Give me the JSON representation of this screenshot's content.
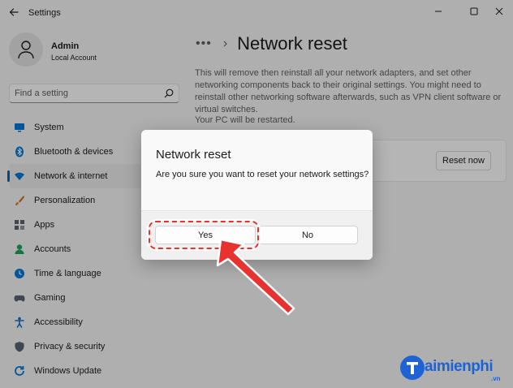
{
  "window": {
    "title": "Settings",
    "controls": [
      "minimize-icon",
      "maximize-icon",
      "close-icon"
    ]
  },
  "user": {
    "name": "Admin",
    "account_type": "Local Account"
  },
  "search": {
    "placeholder": "Find a setting"
  },
  "sidebar": {
    "items": [
      {
        "label": "System",
        "icon": "monitor-icon",
        "color": "#0078d4"
      },
      {
        "label": "Bluetooth & devices",
        "icon": "bluetooth-icon",
        "color": "#0078d4"
      },
      {
        "label": "Network & internet",
        "icon": "wifi-icon",
        "color": "#0078d4",
        "active": true
      },
      {
        "label": "Personalization",
        "icon": "brush-icon",
        "color": "#c96d1a"
      },
      {
        "label": "Apps",
        "icon": "apps-icon",
        "color": "#5a6270"
      },
      {
        "label": "Accounts",
        "icon": "person-icon",
        "color": "#1aa260"
      },
      {
        "label": "Time & language",
        "icon": "globe-clock-icon",
        "color": "#0078d4"
      },
      {
        "label": "Gaming",
        "icon": "gamepad-icon",
        "color": "#5a6270"
      },
      {
        "label": "Accessibility",
        "icon": "accessibility-icon",
        "color": "#0f6cbd"
      },
      {
        "label": "Privacy & security",
        "icon": "shield-icon",
        "color": "#5a6270"
      },
      {
        "label": "Windows Update",
        "icon": "refresh-icon",
        "color": "#0078d4"
      }
    ]
  },
  "content": {
    "breadcrumb_more": "•••",
    "breadcrumb_sep": "›",
    "title": "Network reset",
    "description": "This will remove then reinstall all your network adapters, and set other networking components back to their original settings. You might need to reinstall other networking software afterwards, such as VPN client software or virtual switches.",
    "restart_note": "Your PC will be restarted.",
    "reset_button": "Reset now"
  },
  "dialog": {
    "title": "Network reset",
    "message": "Are you sure you want to reset your network settings?",
    "yes_label": "Yes",
    "no_label": "No"
  },
  "annotation": {
    "color": "#e8322f",
    "target": "Yes"
  },
  "watermark": {
    "text": "aimienphi",
    "suffix": ".vn",
    "logo_letter": "T",
    "color": "#1e63d6"
  }
}
